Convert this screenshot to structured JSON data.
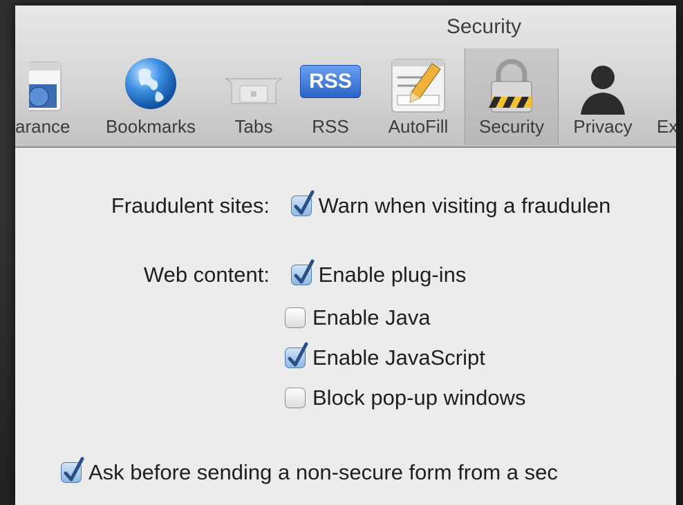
{
  "window": {
    "title": "Security"
  },
  "toolbar": {
    "tabs": [
      {
        "label": "arance",
        "icon": "appearance-icon"
      },
      {
        "label": "Bookmarks",
        "icon": "globe-icon"
      },
      {
        "label": "Tabs",
        "icon": "tabs-icon"
      },
      {
        "label": "RSS",
        "icon": "rss-icon",
        "badge": "RSS"
      },
      {
        "label": "AutoFill",
        "icon": "autofill-pencil-icon"
      },
      {
        "label": "Security",
        "icon": "padlock-icon",
        "selected": true
      },
      {
        "label": "Privacy",
        "icon": "person-silhouette-icon"
      },
      {
        "label": "Ex",
        "icon": ""
      }
    ]
  },
  "security": {
    "fraudulent": {
      "label": "Fraudulent sites:",
      "option": {
        "label": "Warn when visiting a fraudulen",
        "checked": true
      }
    },
    "web_content": {
      "label": "Web content:",
      "options": [
        {
          "label": "Enable plug-ins",
          "checked": true
        },
        {
          "label": "Enable Java",
          "checked": false
        },
        {
          "label": "Enable JavaScript",
          "checked": true
        },
        {
          "label": "Block pop-up windows",
          "checked": false
        }
      ]
    },
    "nonsecure_form": {
      "label": "Ask before sending a non-secure form from a sec",
      "checked": true
    }
  },
  "colors": {
    "check": "#2a4f86",
    "checked_box": "#8fb8e2",
    "window_bg": "#ececec"
  }
}
